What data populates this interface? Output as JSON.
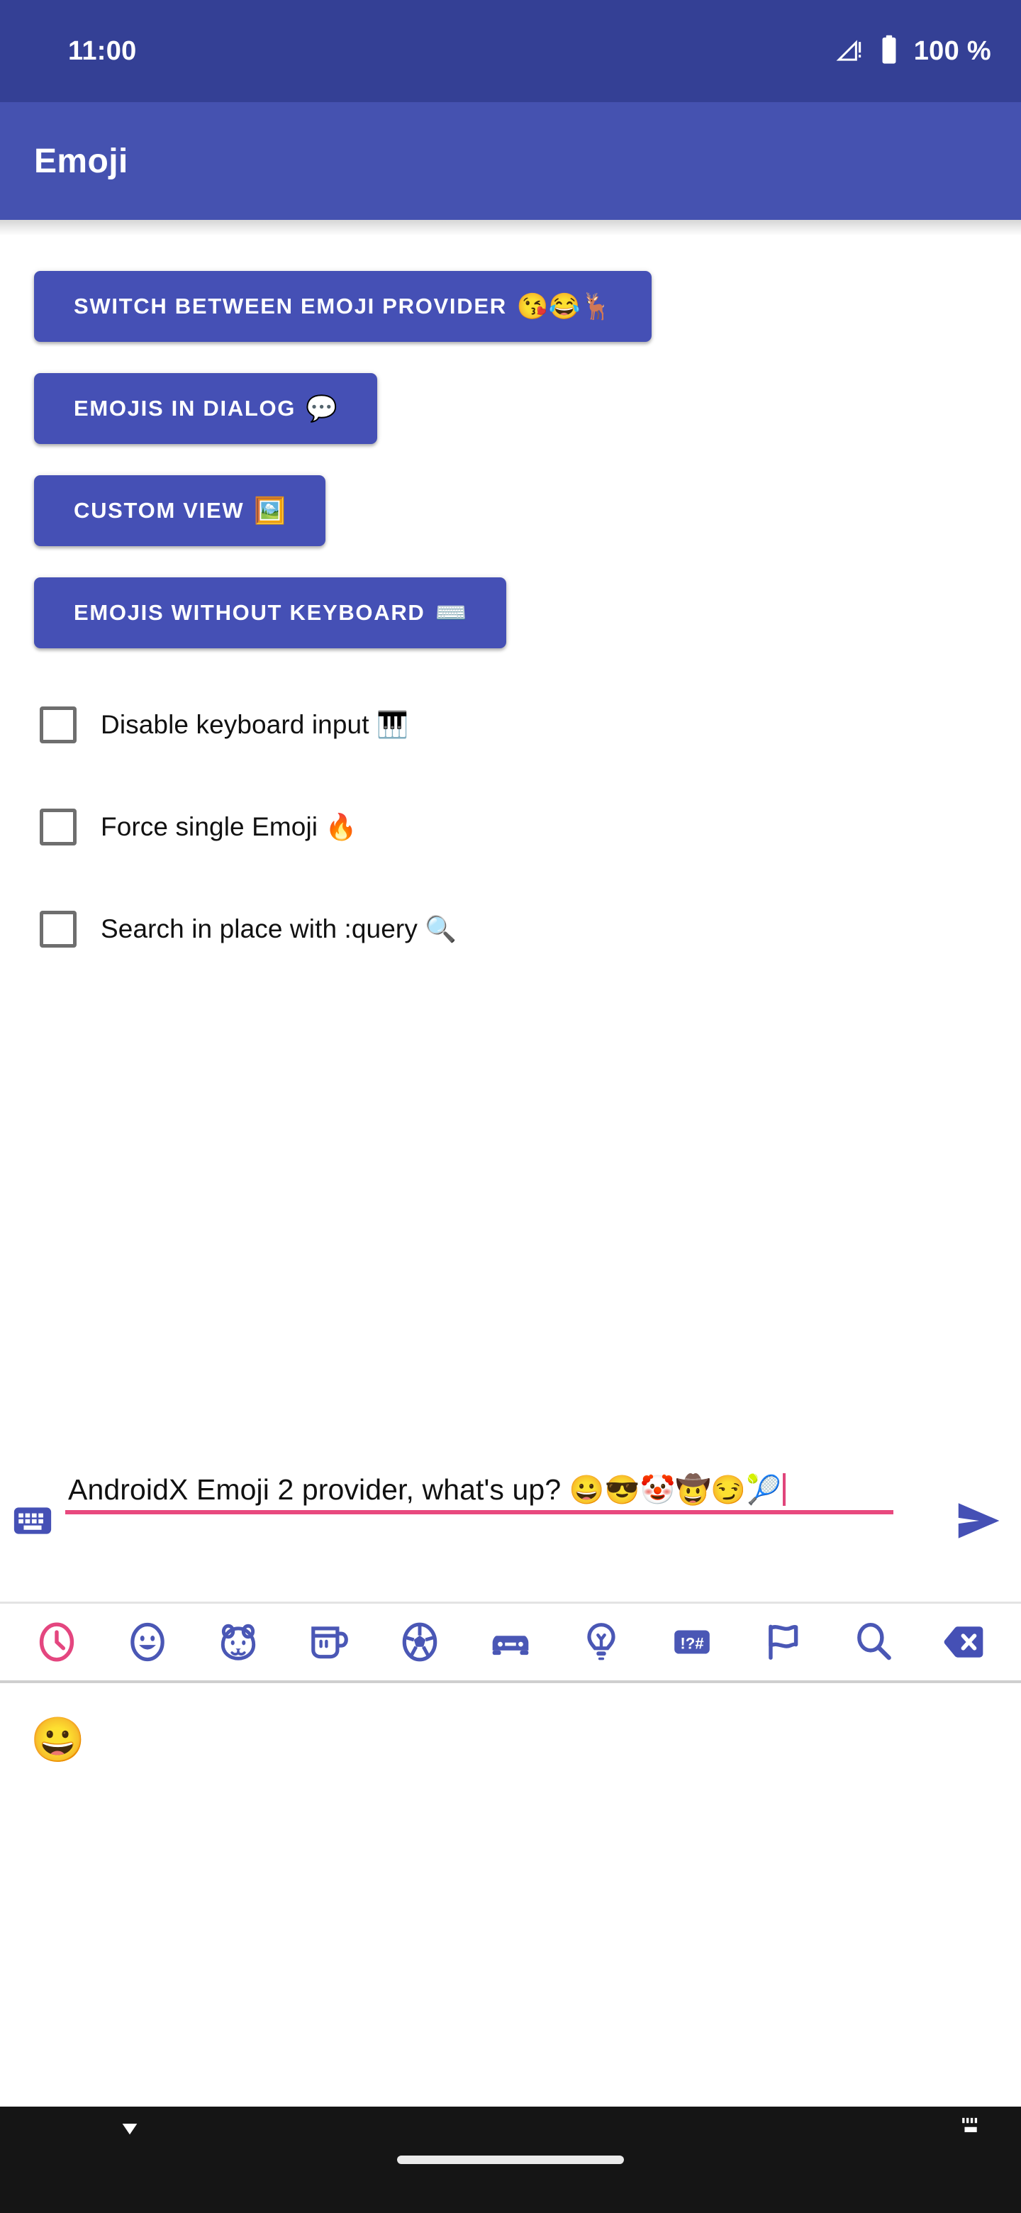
{
  "status_bar": {
    "time": "11:00",
    "battery_text": "100 %",
    "signal_icon": "signal-no-sim-icon",
    "battery_icon": "battery-full-icon",
    "background_color": "#344095"
  },
  "app_bar": {
    "title": "Emoji",
    "background_color": "#4552b0",
    "text_color": "#ffffff"
  },
  "buttons": [
    {
      "label": "SWITCH BETWEEN EMOJI PROVIDER",
      "emoji": "😘😂🦌",
      "name": "switch-emoji-provider-button"
    },
    {
      "label": "EMOJIS IN DIALOG",
      "emoji": "💬",
      "name": "emojis-in-dialog-button"
    },
    {
      "label": "CUSTOM VIEW",
      "emoji": "🖼️",
      "name": "custom-view-button"
    },
    {
      "label": "EMOJIS WITHOUT KEYBOARD",
      "emoji": "⌨️",
      "name": "emojis-without-keyboard-button"
    }
  ],
  "button_color": "#4550b5",
  "checkboxes": [
    {
      "label": "Disable keyboard input",
      "emoji": "🎹",
      "checked": false,
      "name": "disable-keyboard-input-checkbox"
    },
    {
      "label": "Force single Emoji",
      "emoji": "🔥",
      "checked": false,
      "name": "force-single-emoji-checkbox"
    },
    {
      "label": "Search in place with :query",
      "emoji": "🔍",
      "checked": false,
      "name": "search-in-place-checkbox"
    }
  ],
  "input": {
    "text": "AndroidX Emoji 2 provider, what's up? ",
    "text_emoji": "😀😎🤡🤠😏",
    "text_emoji_2": "🎾",
    "placeholder": "",
    "underline_color": "#e8497e",
    "caret_color": "#e0457b",
    "keyboard_toggle_icon": "keyboard-icon",
    "send_icon": "send-icon"
  },
  "picker": {
    "selected_tab": "recent",
    "accent_color": "#4550b5",
    "selected_color": "#e4467f",
    "tabs": [
      {
        "id": "recent",
        "icon": "clock-icon",
        "label": "Recent",
        "selected": true
      },
      {
        "id": "smileys",
        "icon": "smiley-face-icon",
        "label": "Smileys & Emotion",
        "selected": false
      },
      {
        "id": "animals",
        "icon": "animal-face-icon",
        "label": "Animals & Nature",
        "selected": false
      },
      {
        "id": "food",
        "icon": "cup-icon",
        "label": "Food & Drink",
        "selected": false
      },
      {
        "id": "activities",
        "icon": "soccer-ball-icon",
        "label": "Activities",
        "selected": false
      },
      {
        "id": "travel",
        "icon": "car-icon",
        "label": "Travel & Places",
        "selected": false
      },
      {
        "id": "objects",
        "icon": "lightbulb-icon",
        "label": "Objects",
        "selected": false
      },
      {
        "id": "symbols",
        "icon": "symbols-icon",
        "label": "Symbols",
        "selected": false
      },
      {
        "id": "flags",
        "icon": "flag-icon",
        "label": "Flags",
        "selected": false
      },
      {
        "id": "search",
        "icon": "search-icon",
        "label": "Search",
        "selected": false
      },
      {
        "id": "backspace",
        "icon": "backspace-icon",
        "label": "Backspace",
        "selected": false
      }
    ],
    "recent_emojis": [
      "😀"
    ]
  },
  "nav_bar": {
    "background_color": "#151515",
    "back_icon": "chevron-down-icon",
    "pill_icon": "home-pill-icon",
    "switch_keyboard_icon": "keyboard-switch-icon"
  }
}
